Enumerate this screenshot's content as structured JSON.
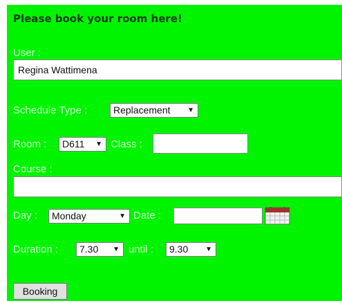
{
  "form": {
    "heading": "Please book your room here!",
    "user_label": "User :",
    "user_value": "Regina Wattimena",
    "schedule_type_label": "Schedule Type :",
    "schedule_type_value": "Replacement",
    "room_label": "Room :",
    "room_value": "D611",
    "class_label": "Class :",
    "class_value": "",
    "course_label": "Course :",
    "course_value": "",
    "day_label": "Day :",
    "day_value": "Monday",
    "date_label": "Date :",
    "date_value": "",
    "duration_label": "Duration :",
    "duration_from": "7.30",
    "until_label": "until :",
    "duration_until": "9.30",
    "booking_button": "Booking"
  },
  "icons": {
    "dropdown_arrow": "chevron-down-icon",
    "calendar": "calendar-icon"
  },
  "colors": {
    "panel_background": "#00f400",
    "label_text": "#d7ffd7",
    "heading_text": "#103a10"
  }
}
